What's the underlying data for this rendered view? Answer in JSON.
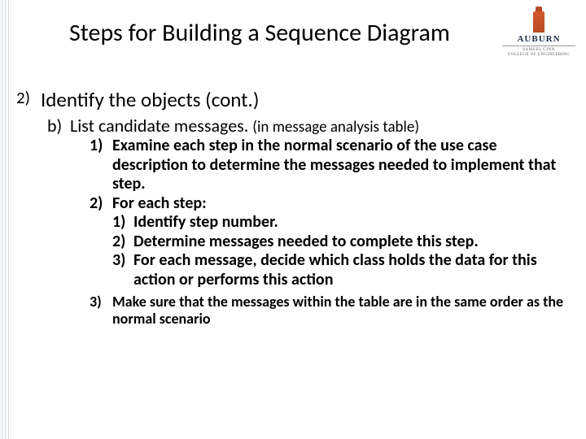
{
  "logo": {
    "word": "AUBURN",
    "sub1": "SAMUEL GINN",
    "sub2": "COLLEGE OF ENGINEERING"
  },
  "title": "Steps for Building a Sequence Diagram",
  "step2": {
    "num": "2)",
    "text": "Identify the objects (cont.)"
  },
  "b": {
    "num": "b)",
    "text": "List candidate messages.",
    "paren": "(in message analysis table)"
  },
  "i1": {
    "num": "1)",
    "text": "Examine each step in the normal scenario of the use case description to determine the messages needed to implement that step."
  },
  "i2": {
    "num": "2)",
    "text": "For each step:"
  },
  "i2_1": {
    "num": "1)",
    "text": "Identify step number."
  },
  "i2_2": {
    "num": "2)",
    "text": "Determine messages needed to complete this step."
  },
  "i2_3": {
    "num": "3)",
    "text": "For each message, decide which class holds the data for this action or performs this action"
  },
  "i3": {
    "num": "3)",
    "text": "Make sure that the messages within the table are in the same order as the normal scenario"
  }
}
